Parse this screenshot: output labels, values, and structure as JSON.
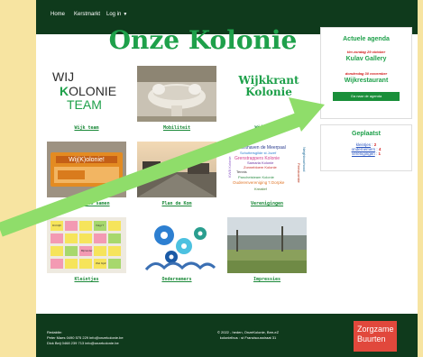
{
  "nav": {
    "home": "Home",
    "kerstmarkt": "Kerstmarkt",
    "login": "Log in"
  },
  "site_title": "Onze Kolonie",
  "tiles": [
    {
      "caption": "Wijk team",
      "logo": {
        "line1": "WIJ",
        "line2_k": "K",
        "line2_rest": "OLONIE",
        "line3": "TEAM"
      }
    },
    {
      "caption": "Mobiliteit"
    },
    {
      "caption": "Wijkkrant",
      "logo": {
        "line1": "Wijkkrant",
        "line2": "Kolonie"
      }
    },
    {
      "caption": "Zorgzame en samen",
      "label": "Wij(K)olonie!"
    },
    {
      "caption": "Plan de Kom"
    },
    {
      "caption": "Verenigingen",
      "words": [
        "Jachthaven de Meerpaal",
        "Schuttersgilde st Jozef",
        "Grenstrappers Kolonie",
        "Samaria Kolonie",
        "Zonnebloem Kolonie",
        "Tennis",
        "Pancheisteam Kolonie",
        "Ouderenvereniging 't Dorpke",
        "KWB Kolonie",
        "Neighbourhood",
        "Feestcomite",
        "Kreatief"
      ]
    },
    {
      "caption": "Kleintjes",
      "notes": [
        "Dit blijft",
        "Volgt ?",
        "Bijzonder",
        "Wel bijdr"
      ]
    },
    {
      "caption": "Ondernemers"
    },
    {
      "caption": "Impressies"
    }
  ],
  "agenda": {
    "title": "Actuele agenda",
    "items": [
      {
        "date": "t/m zondag 29 oktober",
        "name": "Kulav Gallery"
      },
      {
        "date": "donderdag 30 november",
        "name": "Wijkrestaurant"
      }
    ],
    "button": "Ga naar de agenda"
  },
  "placed": {
    "title": "Geplaatst",
    "rows": [
      {
        "label": "kleintjes",
        "count": "2"
      },
      {
        "label": "ondernemers",
        "count": "4"
      },
      {
        "label": "verenigingen",
        "count": "1"
      }
    ]
  },
  "footer": {
    "left": [
      "Redaktie:",
      "Peter Maes 0490 575 229 info@onzekolonie.be",
      "Dick Beij   0468 239 713 info@onzekolonie.be"
    ],
    "mid": [
      "© 2022 - heden, OnzeKolonie, Bee-eZ",
      "kolonielbus : st Franciscusstraat 31"
    ],
    "badge": [
      "Zorgzame",
      "Buurten"
    ]
  },
  "colors": {
    "accent": "#1ea04a",
    "nav_bg": "#0f3a1c",
    "arrow": "#8fdd6a",
    "badge": "#e1483c",
    "page_bg": "#f7e4a1"
  }
}
